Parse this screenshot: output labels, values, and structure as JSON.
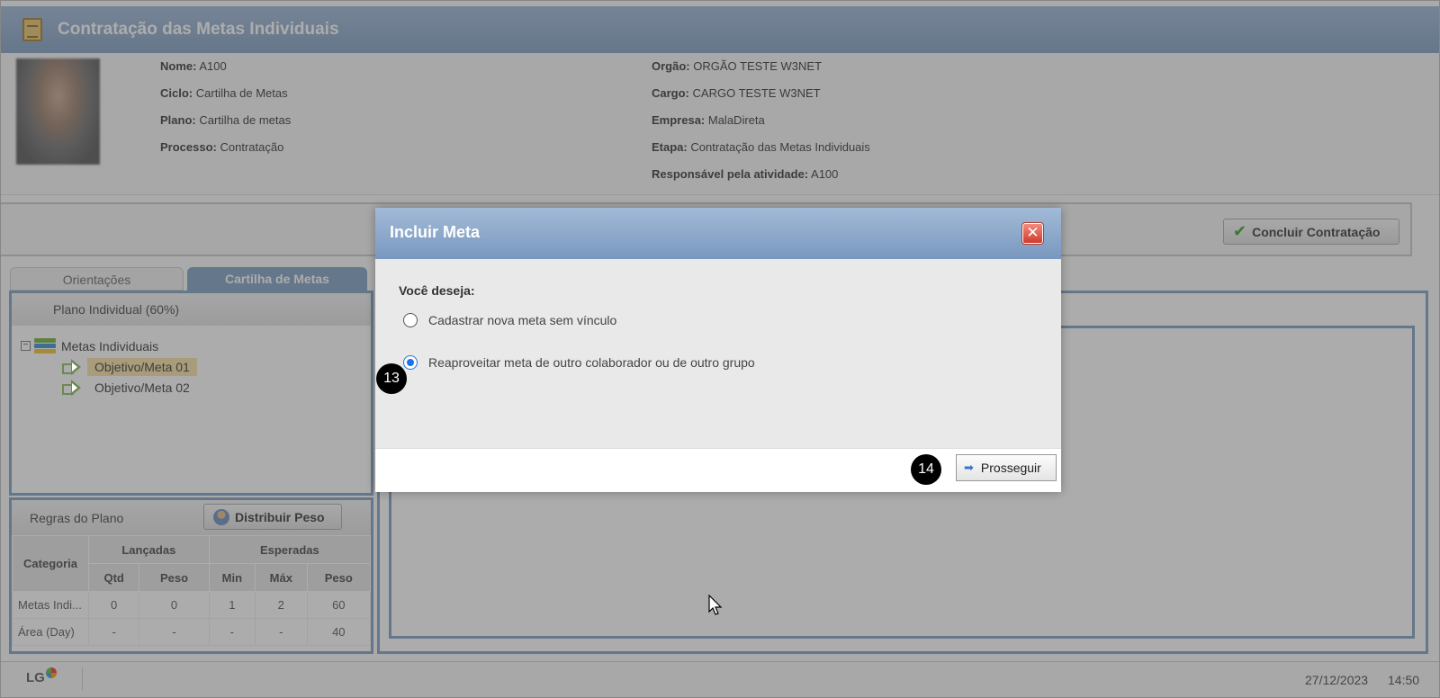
{
  "header": {
    "title": "Contratação das Metas Individuais"
  },
  "info": {
    "left": [
      {
        "label": "Nome:",
        "value": "A100"
      },
      {
        "label": "Ciclo:",
        "value": "Cartilha de Metas"
      },
      {
        "label": "Plano:",
        "value": "Cartilha de metas"
      },
      {
        "label": "Processo:",
        "value": "Contratação"
      }
    ],
    "right": [
      {
        "label": "Orgão:",
        "value": "ORGÃO TESTE W3NET"
      },
      {
        "label": "Cargo:",
        "value": "CARGO TESTE W3NET"
      },
      {
        "label": "Empresa:",
        "value": "MalaDireta"
      },
      {
        "label": "Etapa:",
        "value": "Contratação das Metas Individuais"
      },
      {
        "label": "Responsável pela atividade:",
        "value": "A100"
      }
    ]
  },
  "toolbar": {
    "concluir_label": "Concluir Contratação"
  },
  "tabs": [
    {
      "label": "Orientações"
    },
    {
      "label": "Cartilha de Metas"
    }
  ],
  "plan": {
    "header": "Plano Individual (60%)",
    "root": "Metas Individuais",
    "items": [
      "Objetivo/Meta 01",
      "Objetivo/Meta 02"
    ]
  },
  "rules": {
    "header": "Regras do Plano",
    "distribuir_label": "Distribuir Peso",
    "columns": {
      "categoria": "Categoria",
      "lancadas": "Lançadas",
      "esperadas": "Esperadas",
      "qtd": "Qtd",
      "peso": "Peso",
      "min": "Min",
      "max": "Máx",
      "peso2": "Peso"
    },
    "rows": [
      [
        "Metas Indi...",
        "0",
        "0",
        "1",
        "2",
        "60"
      ],
      [
        "Área (Day)",
        "-",
        "-",
        "-",
        "-",
        "40"
      ]
    ]
  },
  "footer": {
    "logo": "LG",
    "date": "27/12/2023",
    "time": "14:50"
  },
  "dialog": {
    "title": "Incluir Meta",
    "question": "Você deseja:",
    "option1": "Cadastrar nova meta sem vínculo",
    "option2": "Reaproveitar meta de outro colaborador ou de outro grupo",
    "selected": "option2",
    "proceed_label": "Prosseguir"
  },
  "badges": {
    "step13": "13",
    "step14": "14"
  },
  "colors": {
    "header_blue": "#7f9ec2",
    "highlight": "#f7e2a5",
    "radio_blue": "#1a73e8",
    "close_red": "#d13b2b"
  }
}
